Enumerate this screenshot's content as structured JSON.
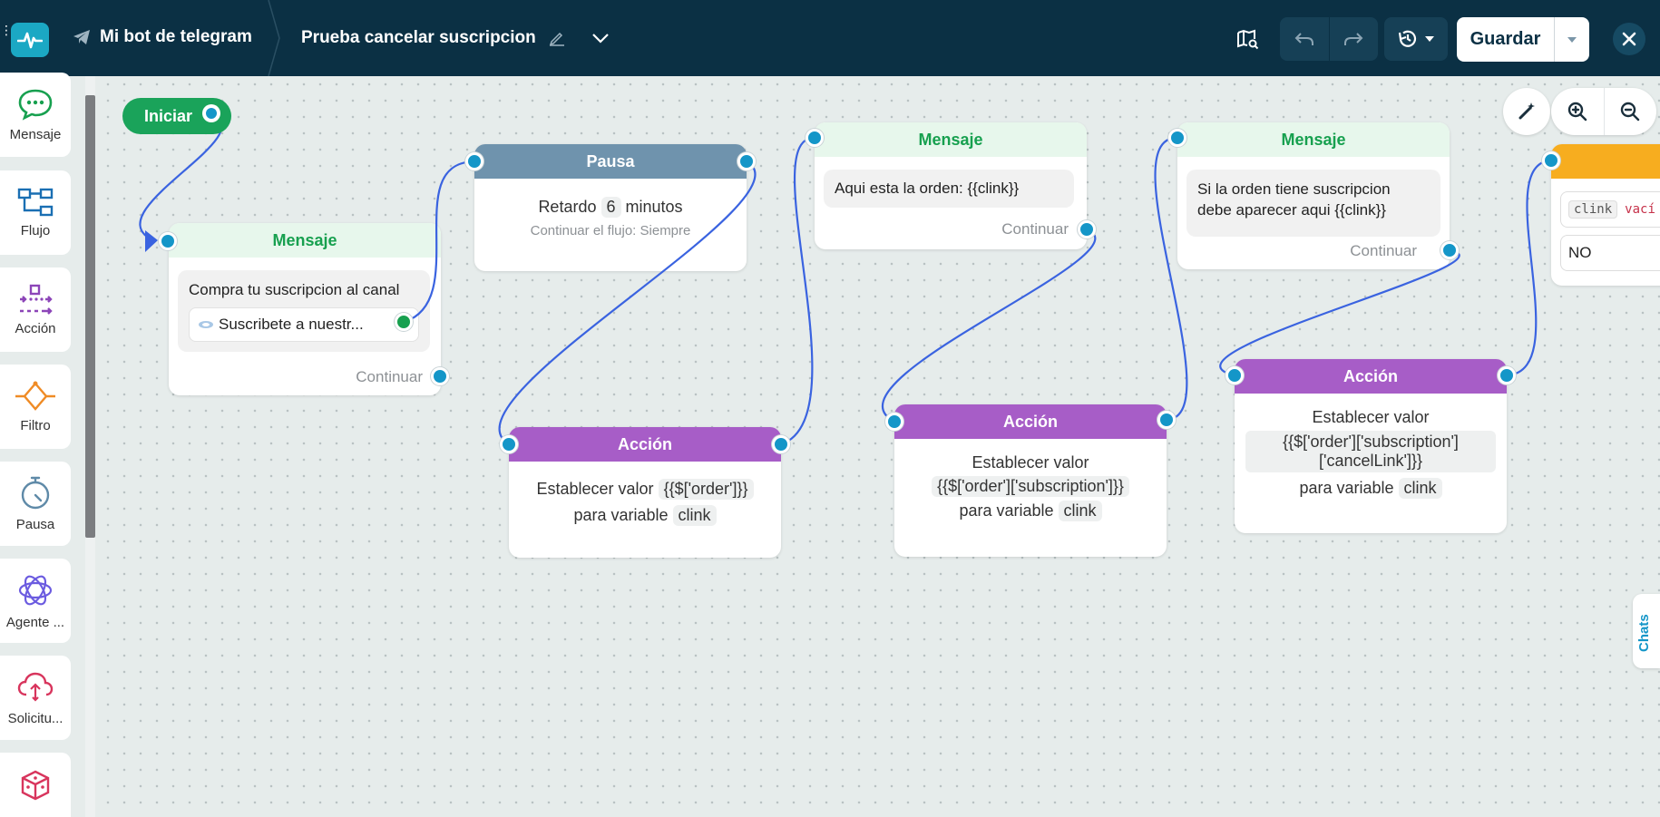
{
  "header": {
    "bot_name": "Mi bot de telegram",
    "flow_name": "Prueba cancelar suscripcion",
    "save_label": "Guardar"
  },
  "sidebar": {
    "items": [
      {
        "label": "Mensaje",
        "icon": "chat-bubble-icon"
      },
      {
        "label": "Flujo",
        "icon": "flow-icon"
      },
      {
        "label": "Acción",
        "icon": "action-icon"
      },
      {
        "label": "Filtro",
        "icon": "filter-icon"
      },
      {
        "label": "Pausa",
        "icon": "timer-icon"
      },
      {
        "label": "Agente ...",
        "icon": "ai-agent-icon"
      },
      {
        "label": "Solicitu...",
        "icon": "cloud-request-icon"
      },
      {
        "label": "",
        "icon": "dice-icon"
      }
    ]
  },
  "canvas": {
    "start_label": "Iniciar",
    "node1": {
      "title": "Mensaje",
      "text": "Compra tu suscripcion al canal",
      "button": "Suscribete a nuestr...",
      "continue": "Continuar"
    },
    "node2": {
      "title": "Pausa",
      "delay_prefix": "Retardo",
      "delay_value": "6",
      "delay_unit": "minutos",
      "subtext": "Continuar el flujo: Siempre"
    },
    "node3": {
      "title": "Acción",
      "set_label": "Establecer valor",
      "value": "{{$['order']}}",
      "var_label": "para variable",
      "var": "clink"
    },
    "node4": {
      "title": "Mensaje",
      "text": "Aqui esta la orden: {{clink}}",
      "continue": "Continuar"
    },
    "node5": {
      "title": "Acción",
      "set_label": "Establecer valor",
      "value": "{{$['order']['subscription']}}",
      "var_label": "para variable",
      "var": "clink"
    },
    "node6": {
      "title": "Mensaje",
      "text_line1": "Si la orden tiene suscripcion",
      "text_line2": "debe aparecer aqui {{clink}}",
      "continue": "Continuar"
    },
    "node7": {
      "title": "Acción",
      "set_label": "Establecer valor",
      "value_line1": "{{$['order']['subscription']",
      "value_line2": "['cancelLink']}}",
      "var_label": "para variable",
      "var": "clink"
    },
    "node8": {
      "cond_var": "clink",
      "cond_op": "vací",
      "value": "NO"
    }
  },
  "chats_tab": "Chats",
  "colors": {
    "topbar": "#0b3044",
    "message": "#17a04f",
    "pause": "#6f93ad",
    "action": "#a75dc7",
    "connector": "#1496c8",
    "wire": "#3a63e0"
  }
}
